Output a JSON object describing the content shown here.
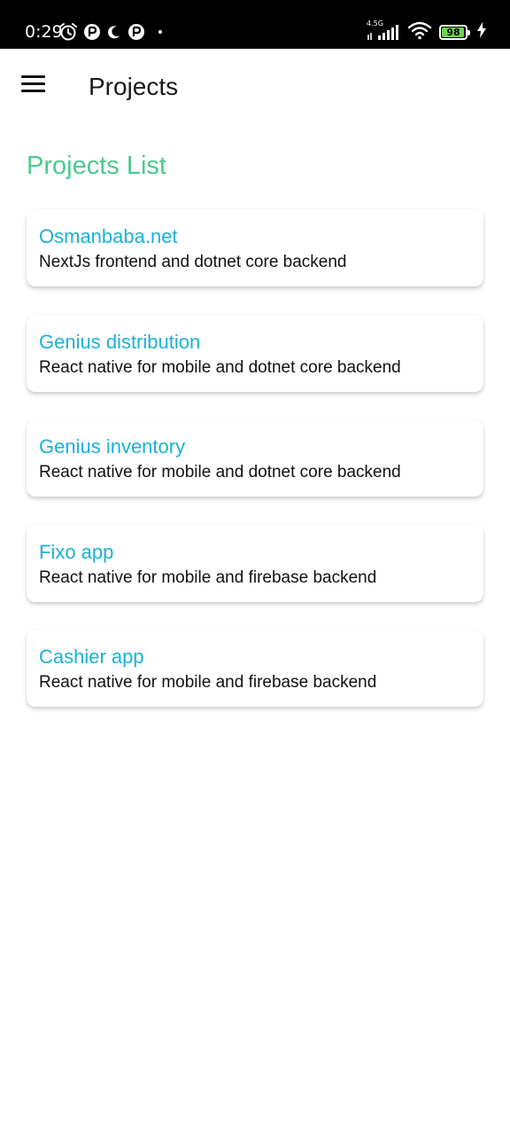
{
  "status_bar": {
    "time": "0:29",
    "network_type": "4.5G",
    "battery_level": "98",
    "battery_percent": 98,
    "left_icons": [
      "alarm-icon",
      "notification-app-icon",
      "moon-icon",
      "notification-app-icon",
      "dot-icon"
    ],
    "right_icons": [
      "signal-icon",
      "wifi-icon",
      "battery-icon",
      "charging-icon"
    ]
  },
  "header": {
    "title": "Projects",
    "menu_icon": "hamburger-menu-icon"
  },
  "main": {
    "section_title": "Projects List",
    "projects": [
      {
        "name": "Osmanbaba.net",
        "description": "NextJs frontend and dotnet core backend"
      },
      {
        "name": "Genius distribution",
        "description": "React native for mobile and dotnet core backend"
      },
      {
        "name": "Genius inventory",
        "description": "React native for mobile and dotnet core backend"
      },
      {
        "name": "Fixo app",
        "description": "React native for mobile and firebase backend"
      },
      {
        "name": "Cashier app",
        "description": "React native for mobile and firebase backend"
      }
    ]
  },
  "colors": {
    "accent_green": "#4cc98e",
    "project_name_blue": "#1ab1d8",
    "status_bar": "#000000",
    "battery_green": "#6cd44a"
  }
}
